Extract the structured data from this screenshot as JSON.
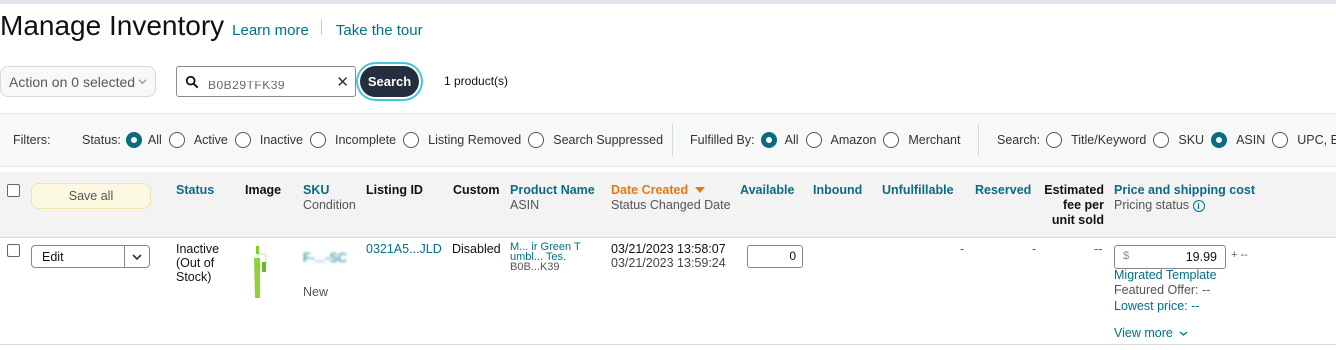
{
  "header": {
    "title": "Manage Inventory",
    "learn_more": "Learn more",
    "tour": "Take the tour"
  },
  "toolbar": {
    "action_label": "Action on 0 selected",
    "search_value": "B0B29TFK39",
    "search_button": "Search",
    "product_count": "1 product(s)"
  },
  "filters": {
    "label": "Filters:",
    "status_label": "Status:",
    "status_options": [
      "All",
      "Active",
      "Inactive",
      "Incomplete",
      "Listing Removed",
      "Search Suppressed"
    ],
    "status_selected": "All",
    "fulfilled_label": "Fulfilled By:",
    "fulfilled_options": [
      "All",
      "Amazon",
      "Merchant"
    ],
    "fulfilled_selected": "All",
    "search_label": "Search:",
    "search_options": [
      "Title/Keyword",
      "SKU",
      "ASIN",
      "UPC, EAN"
    ],
    "search_selected": "ASIN"
  },
  "table": {
    "save_all": "Save all",
    "headers": {
      "status": "Status",
      "image": "Image",
      "sku": "SKU",
      "sku_sub": "Condition",
      "listing_id": "Listing ID",
      "custom": "Custom",
      "product_name": "Product Name",
      "product_name_sub": "ASIN",
      "date_created": "Date Created",
      "date_created_sub": "Status Changed Date",
      "available": "Available",
      "inbound": "Inbound",
      "unfulfillable": "Unfulfillable",
      "reserved": "Reserved",
      "fee_line1": "Estimated",
      "fee_line2": "fee per",
      "fee_line3": "unit sold",
      "price": "Price and shipping cost",
      "price_sub": "Pricing status"
    },
    "row": {
      "edit": "Edit",
      "status_line1": "Inactive",
      "status_line2": "(Out of",
      "status_line3": "Stock)",
      "sku": "F-...-SC",
      "condition": "New",
      "listing_id": "0321A5...JLD",
      "custom": "Disabled",
      "product_name_line1": "M... ir Green T",
      "product_name_line2": "umbl... Tes.",
      "asin": "B0B...K39",
      "date_created": "03/21/2023 13:58:07",
      "status_changed": "03/21/2023 13:59:24",
      "available": "0",
      "inbound": "-",
      "unfulfillable": "-",
      "reserved": "-",
      "fee": "--",
      "currency": "$",
      "price": "19.99",
      "shipping": "+ --",
      "template": "Migrated Template",
      "featured_offer": "Featured Offer: --",
      "lowest_price": "Lowest price: --",
      "view_more": "View more"
    }
  },
  "colors": {
    "accent": "#007185",
    "radio_selected": "#0b6b83",
    "sort_active": "#e47911",
    "search_button": "#232f3e"
  }
}
